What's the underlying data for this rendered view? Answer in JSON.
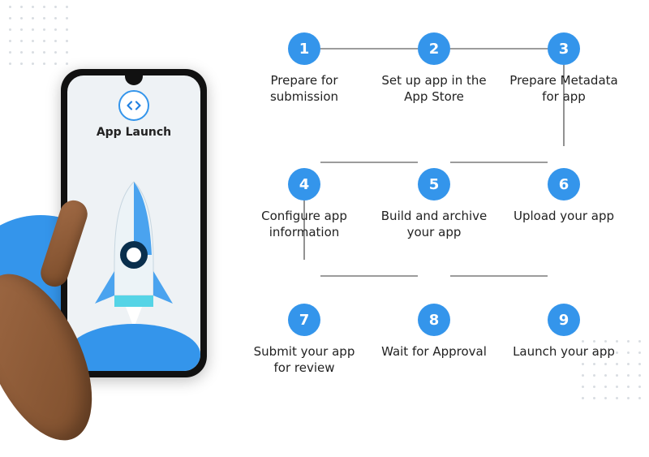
{
  "colors": {
    "accent": "#3495eb",
    "accent_dark": "#1f7fe0",
    "text": "#222222"
  },
  "phone": {
    "badge_icon_name": "code-icon",
    "title": "App Launch",
    "illustration": "rocket-launch"
  },
  "steps": [
    {
      "n": "1",
      "label": "Prepare for submission"
    },
    {
      "n": "2",
      "label": "Set up app in the App Store"
    },
    {
      "n": "3",
      "label": "Prepare Metadata for app"
    },
    {
      "n": "4",
      "label": "Configure app information"
    },
    {
      "n": "5",
      "label": "Build and archive your app"
    },
    {
      "n": "6",
      "label": "Upload your app"
    },
    {
      "n": "7",
      "label": "Submit your app for review"
    },
    {
      "n": "8",
      "label": "Wait for Approval"
    },
    {
      "n": "9",
      "label": "Launch your app"
    }
  ]
}
